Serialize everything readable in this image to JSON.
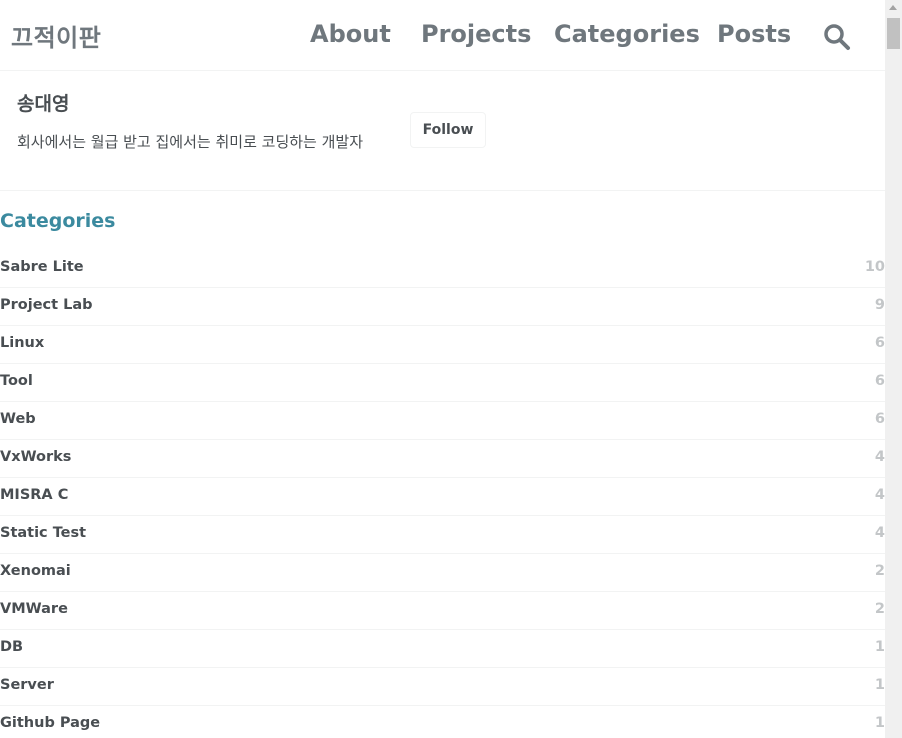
{
  "header": {
    "site_title": "끄적이판",
    "nav": [
      {
        "label": "About"
      },
      {
        "label": "Projects"
      },
      {
        "label": "Categories"
      },
      {
        "label": "Posts"
      }
    ],
    "search_icon": "search-icon"
  },
  "author": {
    "name": "송대영",
    "bio": "회사에서는 월급 받고 집에서는 취미로 코딩하는 개발자",
    "follow_label": "Follow"
  },
  "categories": {
    "title": "Categories",
    "accent_color": "#3b8a9f",
    "items": [
      {
        "name": "Sabre Lite",
        "count": "10"
      },
      {
        "name": "Project Lab",
        "count": "9"
      },
      {
        "name": "Linux",
        "count": "6"
      },
      {
        "name": "Tool",
        "count": "6"
      },
      {
        "name": "Web",
        "count": "6"
      },
      {
        "name": "VxWorks",
        "count": "4"
      },
      {
        "name": "MISRA C",
        "count": "4"
      },
      {
        "name": "Static Test",
        "count": "4"
      },
      {
        "name": "Xenomai",
        "count": "2"
      },
      {
        "name": "VMWare",
        "count": "2"
      },
      {
        "name": "DB",
        "count": "1"
      },
      {
        "name": "Server",
        "count": "1"
      },
      {
        "name": "Github Page",
        "count": "1"
      }
    ]
  }
}
